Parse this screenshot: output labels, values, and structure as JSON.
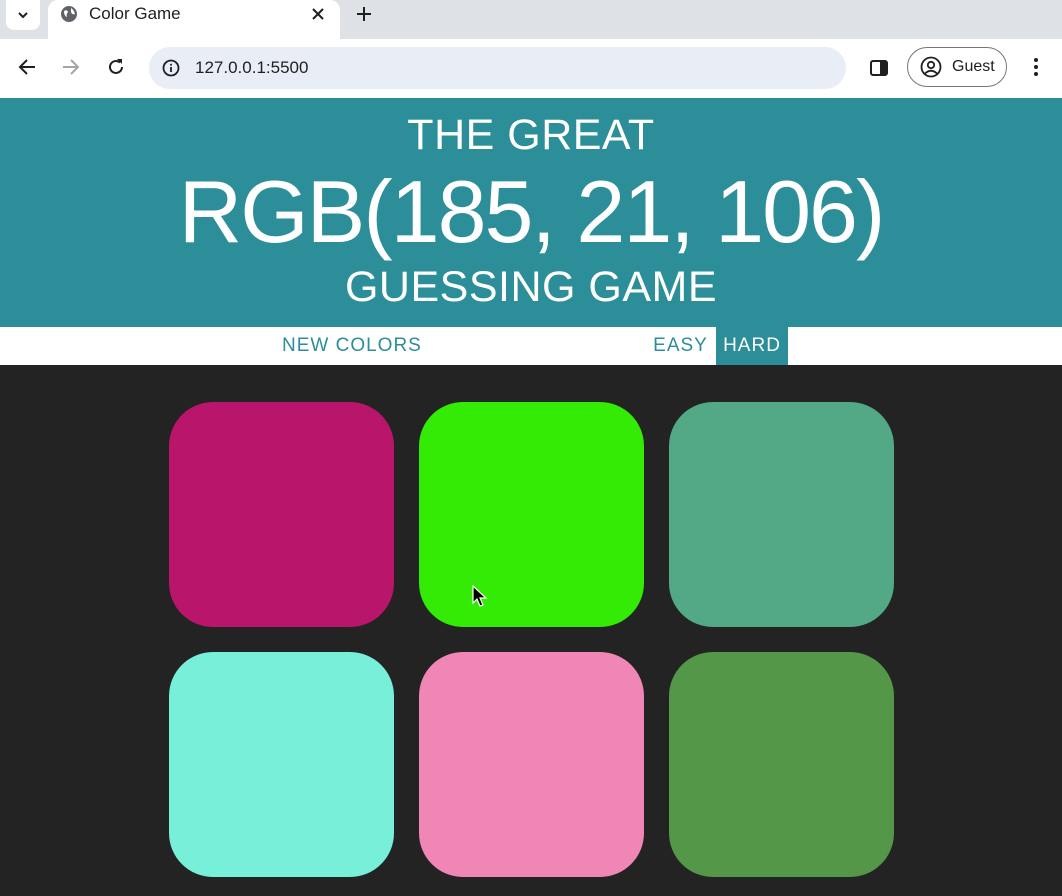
{
  "browser": {
    "tab_title": "Color Game",
    "url": "127.0.0.1:5500",
    "profile_label": "Guest",
    "icons": [
      "tab-list-icon",
      "globe-icon",
      "close-icon",
      "plus-icon",
      "back-arrow-icon",
      "forward-arrow-icon",
      "reload-icon",
      "site-info-icon",
      "side-panel-icon",
      "profile-icon",
      "kebab-menu-icon"
    ]
  },
  "header": {
    "line1": "THE GREAT",
    "rgb_display": "RGB(185, 21, 106)",
    "line3": "GUESSING GAME",
    "background": "#2c8e99"
  },
  "controls": {
    "new_colors": "NEW COLORS",
    "message": "",
    "easy": "EASY",
    "hard": "HARD",
    "selected_mode": "HARD"
  },
  "board": {
    "background": "#232323",
    "squares": [
      {
        "color": "#b9156a"
      },
      {
        "color": "#33eb04"
      },
      {
        "color": "#53a886"
      },
      {
        "color": "#77efd9"
      },
      {
        "color": "#ef86b6"
      },
      {
        "color": "#549749"
      }
    ]
  }
}
